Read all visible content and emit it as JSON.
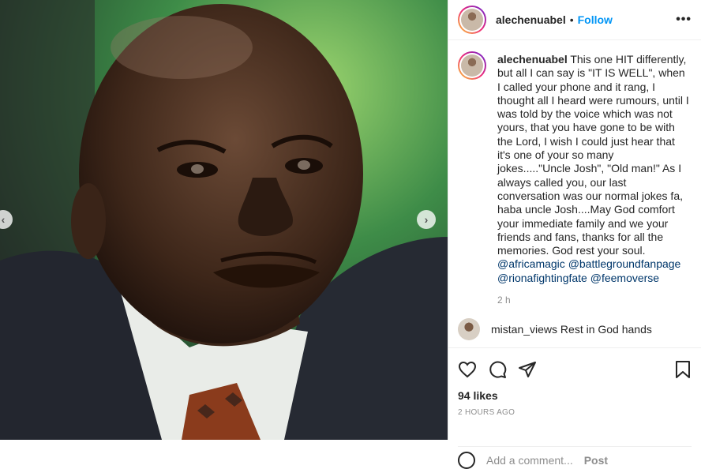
{
  "header": {
    "username": "alechenuabel",
    "separator": "•",
    "follow_label": "Follow",
    "more_label": "•••"
  },
  "caption": {
    "username": "alechenuabel",
    "text": "This one HIT differently, but all I can say is \"IT IS WELL\", when I called your phone and it rang, I thought all I heard were rumours, until I was told by the voice which was not yours, that you have gone to be with the Lord, I wish I could just hear that it's one of your so many jokes.....\"Uncle Josh\", \"Old man!\" As I always called you, our last conversation was our normal jokes fa, haba uncle Josh....May God comfort your immediate family and we your friends and fans, thanks for all the memories. God rest your soul.",
    "mentions": [
      "@africamagic",
      "@battlegroundfanpage",
      "@rionafightingfate",
      "@feemoverse"
    ],
    "time": "2 h"
  },
  "next_comment": {
    "text": "mistan_views Rest in God hands"
  },
  "actions": {
    "icons": [
      "heart-icon",
      "comment-icon",
      "share-icon",
      "bookmark-icon"
    ],
    "likes": "94 likes",
    "posted_ago": "2 HOURS AGO",
    "add_comment_placeholder": "Add a comment...",
    "post_label": "Post"
  },
  "media": {
    "prev_arrow": "‹",
    "next_arrow": "›"
  },
  "colors": {
    "accent": "#0095f6",
    "mention": "#00376b",
    "muted": "#8e8e8e"
  }
}
